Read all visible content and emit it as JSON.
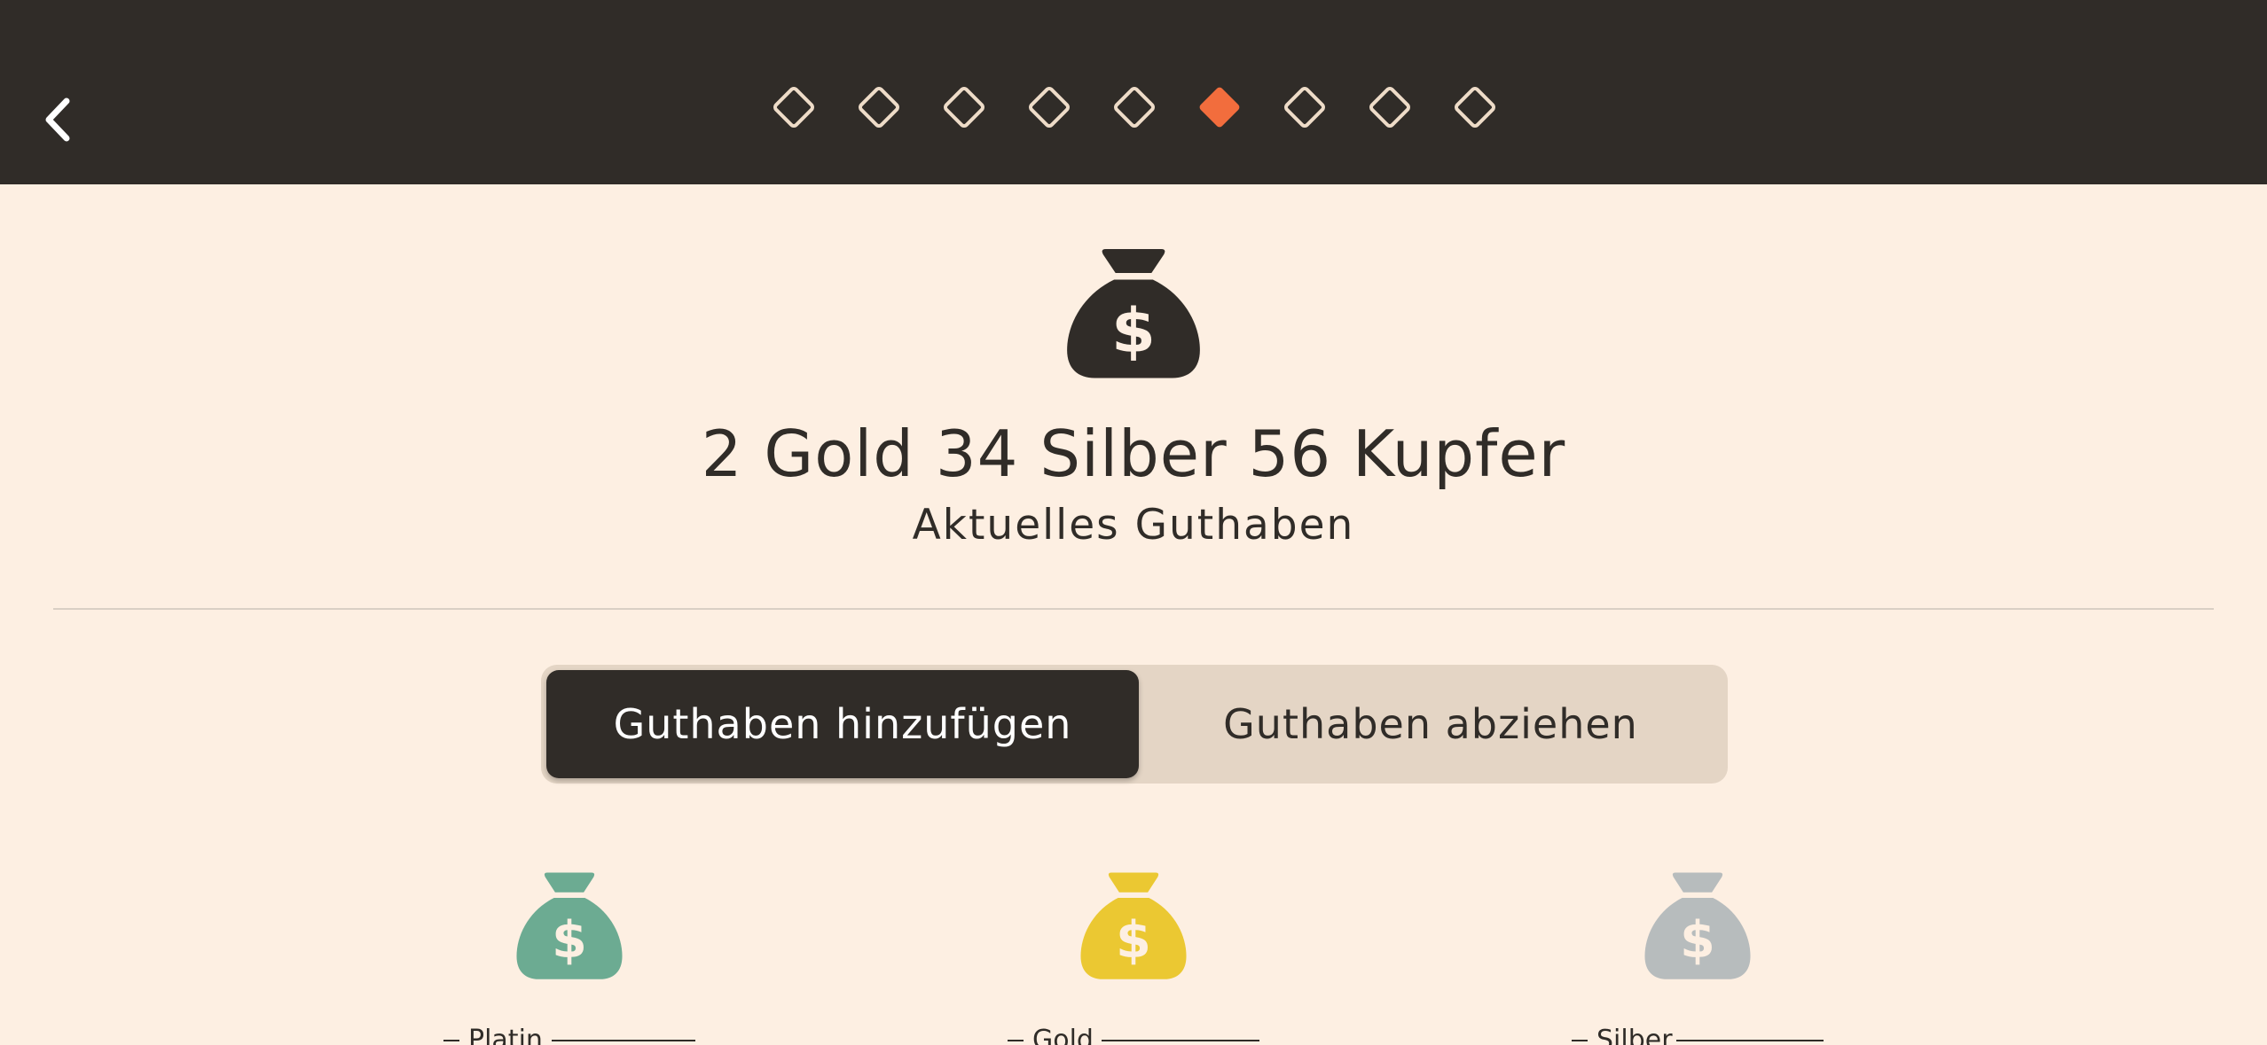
{
  "colors": {
    "header_bg": "#302c28",
    "page_bg": "#fdefe2",
    "accent": "#f26d3d",
    "step_outline": "#eedcc8",
    "platinum": "#6cab92",
    "gold": "#ebc832",
    "silver": "#b7bcbd"
  },
  "nav": {
    "back_icon": "chevron-left-icon",
    "steps": [
      {
        "state": "inactive"
      },
      {
        "state": "inactive"
      },
      {
        "state": "inactive"
      },
      {
        "state": "inactive"
      },
      {
        "state": "inactive"
      },
      {
        "state": "active"
      },
      {
        "state": "inactive"
      },
      {
        "state": "inactive"
      },
      {
        "state": "inactive"
      }
    ]
  },
  "balance": {
    "icon": "money-bag-icon",
    "amount": "2 Gold 34 Silber 56 Kupfer",
    "label": "Aktuelles Guthaben"
  },
  "mode_toggle": {
    "add_label": "Guthaben hinzufügen",
    "subtract_label": "Guthaben abziehen",
    "selected": "add"
  },
  "coins": [
    {
      "label": "Platin",
      "icon": "money-bag-icon",
      "color": "#6cab92"
    },
    {
      "label": "Gold",
      "icon": "money-bag-icon",
      "color": "#ebc832"
    },
    {
      "label": "Silber",
      "icon": "money-bag-icon",
      "color": "#b7bcbd"
    }
  ]
}
